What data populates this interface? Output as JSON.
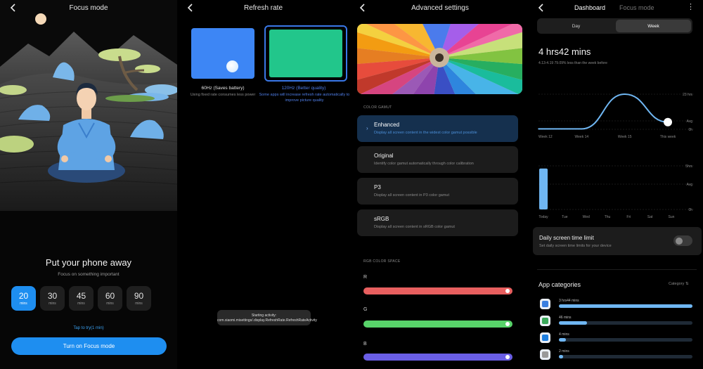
{
  "focus": {
    "title": "Focus mode",
    "heading": "Put your phone away",
    "subheading": "Focus on something important",
    "timers": [
      {
        "value": "20",
        "unit": "mins",
        "selected": true
      },
      {
        "value": "30",
        "unit": "mins",
        "selected": false
      },
      {
        "value": "45",
        "unit": "mins",
        "selected": false
      },
      {
        "value": "60",
        "unit": "mins",
        "selected": false
      },
      {
        "value": "90",
        "unit": "mins",
        "selected": false
      }
    ],
    "try_link": "Tap to try(1 min)",
    "button": "Turn on Focus mode"
  },
  "refresh": {
    "title": "Refresh rate",
    "options": [
      {
        "label": "60Hz (Saves battery)",
        "desc": "Using fixed rate consumes less power",
        "selected": false
      },
      {
        "label": "120Hz (Better quality)",
        "desc": "Some apps will increase refresh rate automatically to improve picture quality",
        "selected": true
      }
    ],
    "toast": "Starting activity: com.xiaomi.misettings/.display.RefreshRate.RefreshRateActivity"
  },
  "advanced": {
    "title": "Advanced settings",
    "gamut_label": "COLOR GAMUT",
    "gamuts": [
      {
        "name": "Enhanced",
        "desc": "Display all screen content in the widest color gamut possible",
        "selected": true
      },
      {
        "name": "Original",
        "desc": "Identify color gamut automatically through color calibration",
        "selected": false
      },
      {
        "name": "P3",
        "desc": "Display all screen content in P3 color gamut",
        "selected": false
      },
      {
        "name": "sRGB",
        "desc": "Display all screen content in sRGB color gamut",
        "selected": false
      }
    ],
    "rgb_label": "RGB COLOR SPACE",
    "channels": [
      {
        "name": "R",
        "color": "#e85f5f",
        "level": 1.0
      },
      {
        "name": "G",
        "color": "#58d36a",
        "level": 1.0
      },
      {
        "name": "B",
        "color": "#6a5ee6",
        "level": 1.0
      }
    ]
  },
  "dashboard": {
    "tabs": [
      "Dashboard",
      "Focus mode"
    ],
    "segments": [
      "Day",
      "Week"
    ],
    "active_segment": "Week",
    "total": "4 hrs42 mins",
    "total_sub": "4.13-4.19  79.09% less than the week before",
    "chart_data": [
      {
        "type": "line",
        "x": [
          "Week 12",
          "Week 14",
          "Week 15",
          "This week"
        ],
        "y_right_labels": [
          "23 hrs",
          "Avg",
          "0h"
        ],
        "ylim": [
          0,
          23
        ],
        "values": [
          0.3,
          0.3,
          23,
          4.7
        ]
      },
      {
        "type": "bar",
        "categories": [
          "Today",
          "Tue",
          "Wed",
          "Thu",
          "Fri",
          "Sat",
          "Sun"
        ],
        "y_right_labels": [
          "5hrs",
          "Avg",
          "0h"
        ],
        "ylim": [
          0,
          5
        ],
        "values": [
          4.7,
          0,
          0,
          0,
          0,
          0,
          0
        ]
      }
    ],
    "limit_title": "Daily screen time limit",
    "limit_sub": "Set daily screen time limits for your device",
    "limit_on": false,
    "categories_title": "App categories",
    "categories_sort": "Category",
    "apps": [
      {
        "time": "3 hrs44 mins",
        "fraction": 1.0,
        "icon_color": "#3a7fe0"
      },
      {
        "time": "46 mins",
        "fraction": 0.21,
        "icon_color": "#3aa85a"
      },
      {
        "time": "4 mins",
        "fraction": 0.05,
        "icon_color": "#1e7fe0"
      },
      {
        "time": "2 mins",
        "fraction": 0.03,
        "icon_color": "#999999"
      }
    ]
  }
}
